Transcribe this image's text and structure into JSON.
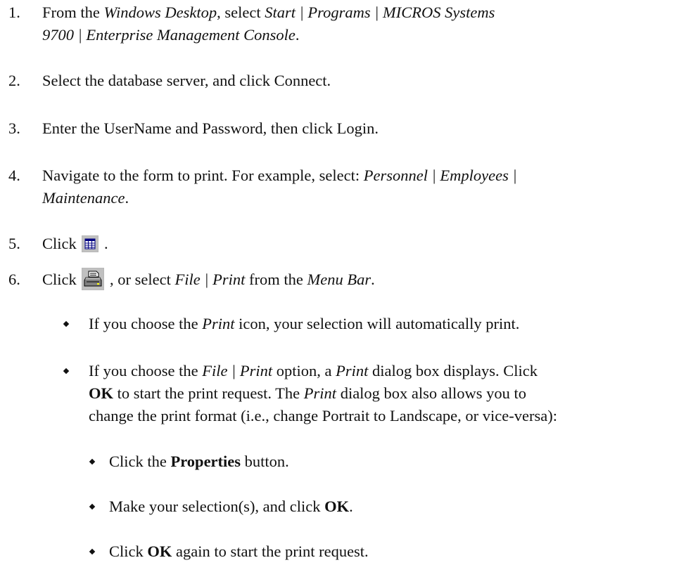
{
  "steps": [
    {
      "num": "1.",
      "a": "From the ",
      "b": "Windows Desktop",
      "c": ", select ",
      "d": "Start | Programs | MICROS Systems",
      "e": "9700 | Enterprise Management Console",
      "f": "."
    },
    {
      "num": "2.",
      "text": "Select the database server, and click Connect."
    },
    {
      "num": "3.",
      "text": "Enter the UserName and Password, then click Login."
    },
    {
      "num": "4.",
      "a": "Navigate to the form to print. For example, select: ",
      "b": "Personnel | Employees |",
      "c": "Maintenance",
      "d": "."
    },
    {
      "num": "5.",
      "a": "Click",
      "b": "."
    },
    {
      "num": "6.",
      "a": "Click",
      "b": ", or select ",
      "c": "File | Print",
      "d": " from the ",
      "e": "Menu Bar",
      "f": "."
    }
  ],
  "bullets": [
    {
      "a": "If you choose the ",
      "b": "Print",
      "c": " icon, your selection will automatically print."
    },
    {
      "a": "If you choose the ",
      "b": "File | Print",
      "c": " option, a ",
      "d": "Print",
      "e": " dialog box displays. Click",
      "f": "OK",
      "g": " to start the print request. The ",
      "h": "Print",
      "i": " dialog box also allows you to",
      "j": "change the print format (i.e., change Portrait to Landscape, or vice-versa):"
    }
  ],
  "subbullets": [
    {
      "a": "Click the ",
      "b": "Properties",
      "c": " button."
    },
    {
      "a": "Make your selection(s), and click ",
      "b": "OK",
      "c": "."
    },
    {
      "a": "Click ",
      "b": "OK",
      "c": " again to start the print request."
    }
  ],
  "icons": {
    "step5": "form-view-icon",
    "step6": "printer-icon"
  }
}
